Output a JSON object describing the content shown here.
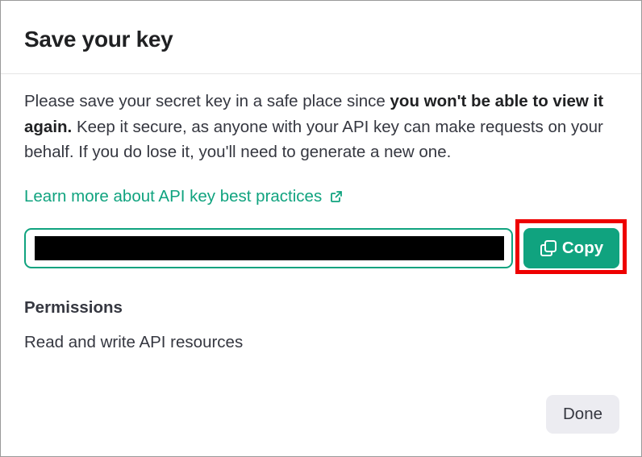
{
  "dialog": {
    "title": "Save your key",
    "description": {
      "part1": "Please save your secret key in a safe place since ",
      "bold": "you won't be able to view it again.",
      "part2": " Keep it secure, as anyone with your API key can make requests on your behalf. If you do lose it, you'll need to generate a new one."
    },
    "learn_link": {
      "label": "Learn more about API key best practices",
      "icon": "external-link-icon"
    },
    "key_field": {
      "value": "",
      "redacted": true
    },
    "copy_button": {
      "label": "Copy",
      "icon": "copy-icon",
      "highlighted": true
    },
    "permissions": {
      "heading": "Permissions",
      "value": "Read and write API resources"
    },
    "done_button": {
      "label": "Done"
    }
  },
  "colors": {
    "accent": "#10a37f",
    "highlight": "#ee0000",
    "text": "#353740",
    "title": "#202123",
    "done_bg": "#ececf1"
  }
}
